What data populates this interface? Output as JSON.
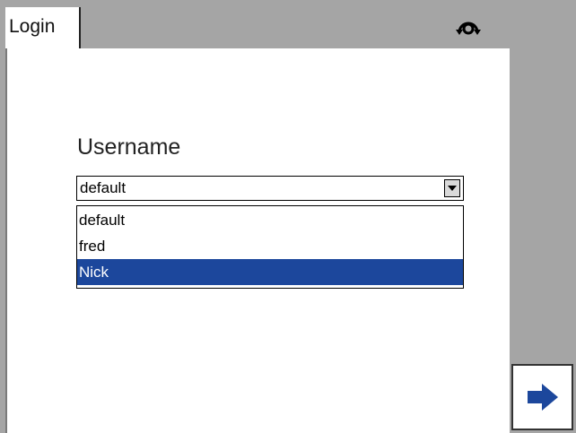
{
  "tab": {
    "label": "Login"
  },
  "form": {
    "username_label": "Username",
    "username_value": "default"
  },
  "dropdown": {
    "options": [
      "default",
      "fred",
      "Nick"
    ],
    "highlighted": "Nick"
  },
  "icons": {
    "sync": "sync-rotate-icon",
    "next": "right-arrow-icon"
  },
  "colors": {
    "background": "#a5a5a5",
    "panel": "#ffffff",
    "selection": "#1c479c",
    "arrow": "#1c479c"
  }
}
